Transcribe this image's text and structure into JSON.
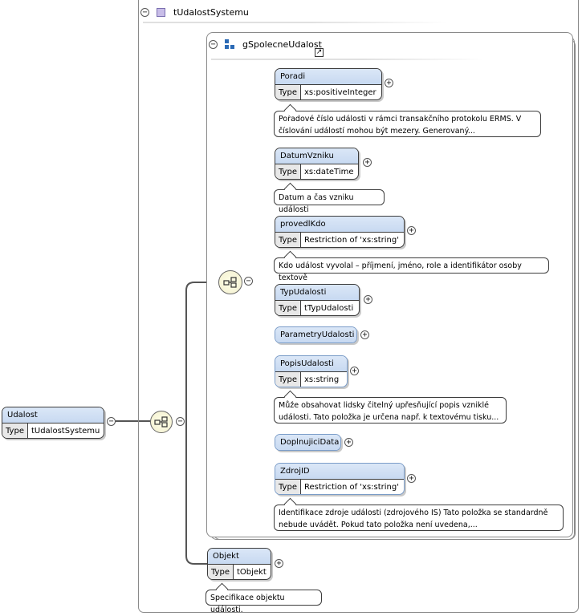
{
  "complex_type": {
    "name": "tUdalostSystemu"
  },
  "root": {
    "name": "Udalost",
    "type_label": "Type",
    "type_value": "tUdalostSystemu"
  },
  "group": {
    "name": "gSpolecneUdalost"
  },
  "elements": [
    {
      "name": "Poradi",
      "type_label": "Type",
      "type_value": "xs:positiveInteger",
      "doc": [
        "Pořadové číslo události v rámci transakčního protokolu ERMS. V",
        "číslování událostí mohou být mezery. Generovaný..."
      ]
    },
    {
      "name": "DatumVzniku",
      "type_label": "Type",
      "type_value": "xs:dateTime",
      "doc": [
        "Datum a čas vzniku události"
      ]
    },
    {
      "name": "provedlKdo",
      "type_label": "Type",
      "type_value": "Restriction of 'xs:string'",
      "doc": [
        "Kdo událost vyvolal – příjmení, jméno, role a identifikátor osoby textově"
      ]
    },
    {
      "name": "TypUdalosti",
      "type_label": "Type",
      "type_value": "tTypUdalosti"
    },
    {
      "name": "ParametryUdalosti"
    },
    {
      "name": "PopisUdalosti",
      "type_label": "Type",
      "type_value": "xs:string",
      "doc": [
        "Může obsahovat lidsky čitelný upřesňující popis vzniklé",
        "události. Tato položka je určena např. k textovému tisku..."
      ]
    },
    {
      "name": "DoplnujiciData"
    },
    {
      "name": "ZdrojID",
      "type_label": "Type",
      "type_value": "Restriction of 'xs:string'",
      "doc": [
        "Identifikace zdroje události (zdrojového IS) Tato položka se standardně",
        "nebude uvádět. Pokud tato položka není uvedena,..."
      ]
    }
  ],
  "objekt": {
    "name": "Objekt",
    "type_label": "Type",
    "type_value": "tObjekt",
    "doc": [
      "Specifikace objektu události."
    ]
  },
  "toggles": {
    "collapse": "−",
    "expand": "+"
  }
}
